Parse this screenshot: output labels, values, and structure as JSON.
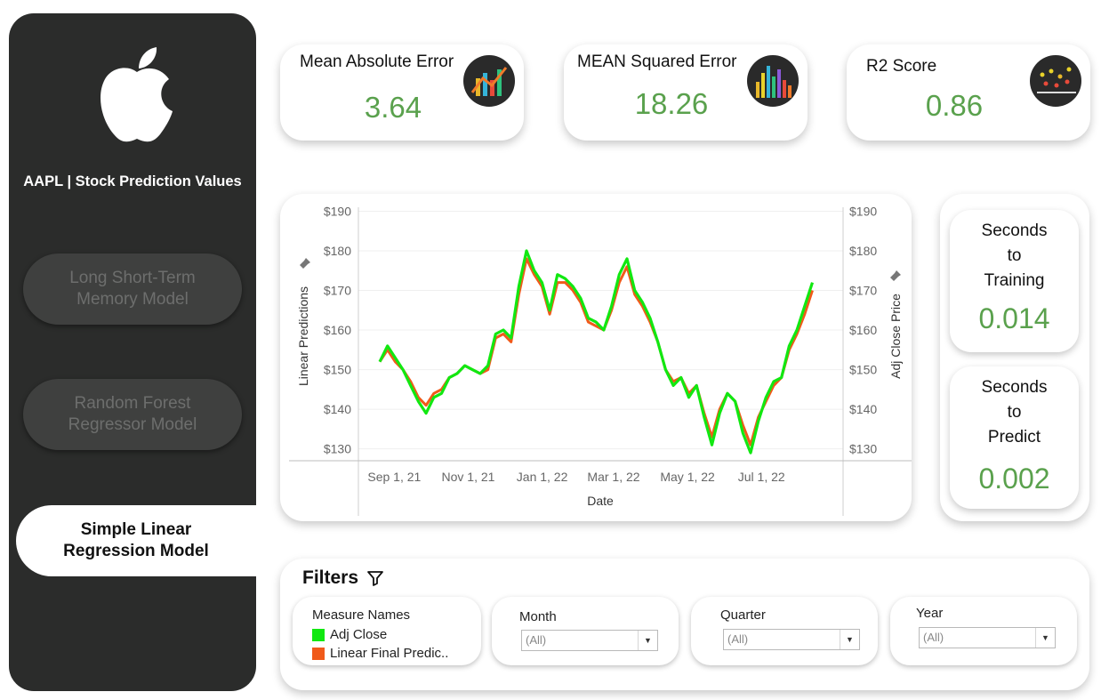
{
  "sidebar": {
    "brand": "AAPL | Stock Prediction Values",
    "models": [
      {
        "label": "Long Short-Term\nMemory Model",
        "active": false
      },
      {
        "label": "Random Forest\nRegressor Model",
        "active": false
      },
      {
        "label": "Simple Linear\nRegression Model",
        "active": true
      }
    ]
  },
  "kpis": {
    "mae": {
      "title": "Mean Absolute Error",
      "value": "3.64",
      "icon": "line-chart-icon"
    },
    "mse": {
      "title": "MEAN Squared Error",
      "value": "18.26",
      "icon": "bar-chart-icon"
    },
    "r2": {
      "title": "R2 Score",
      "value": "0.86",
      "icon": "scatter-plot-icon"
    }
  },
  "timing": {
    "training": {
      "label": "Seconds\nto\nTraining",
      "value": "0.014"
    },
    "predict": {
      "label": "Seconds\nto\nPredict",
      "value": "0.002"
    }
  },
  "filters": {
    "title": "Filters",
    "measure_names": {
      "label": "Measure Names",
      "items": [
        {
          "name": "Adj Close",
          "color": "#11e811"
        },
        {
          "name": "Linear Final Predic..",
          "color": "#f05a1a"
        }
      ]
    },
    "month": {
      "label": "Month",
      "value": "(All)"
    },
    "quarter": {
      "label": "Quarter",
      "value": "(All)"
    },
    "year": {
      "label": "Year",
      "value": "(All)"
    }
  },
  "colors": {
    "accent_green": "#5aa14d",
    "sidebar_bg": "#2b2c2b",
    "adj_close": "#11e811",
    "prediction": "#f05a1a"
  },
  "chart_data": {
    "type": "line",
    "xlabel": "Date",
    "ylabel_left": "Linear Predictions",
    "ylabel_right": "Adj Close Price",
    "x_ticks": [
      "Sep 1, 21",
      "Nov 1, 21",
      "Jan 1, 22",
      "Mar 1, 22",
      "May 1, 22",
      "Jul 1, 22"
    ],
    "y_ticks": [
      "$130",
      "$140",
      "$150",
      "$160",
      "$170",
      "$180",
      "$190"
    ],
    "ylim": [
      127,
      191
    ],
    "x": [
      "2021-08-20",
      "2021-08-27",
      "2021-09-03",
      "2021-09-10",
      "2021-09-17",
      "2021-09-24",
      "2021-10-01",
      "2021-10-08",
      "2021-10-15",
      "2021-10-22",
      "2021-10-29",
      "2021-11-05",
      "2021-11-12",
      "2021-11-19",
      "2021-11-26",
      "2021-12-03",
      "2021-12-10",
      "2021-12-17",
      "2021-12-24",
      "2021-12-31",
      "2022-01-07",
      "2022-01-14",
      "2022-01-21",
      "2022-01-28",
      "2022-02-04",
      "2022-02-11",
      "2022-02-18",
      "2022-02-25",
      "2022-03-04",
      "2022-03-11",
      "2022-03-18",
      "2022-03-25",
      "2022-04-01",
      "2022-04-08",
      "2022-04-15",
      "2022-04-22",
      "2022-04-29",
      "2022-05-06",
      "2022-05-13",
      "2022-05-20",
      "2022-05-27",
      "2022-06-03",
      "2022-06-10",
      "2022-06-17",
      "2022-06-24",
      "2022-07-01",
      "2022-07-08",
      "2022-07-15",
      "2022-07-22",
      "2022-07-29",
      "2022-08-05",
      "2022-08-12"
    ],
    "series": [
      {
        "name": "Adj Close",
        "color": "#11e811",
        "values": [
          152,
          156,
          153,
          150,
          146,
          142,
          139,
          143,
          144,
          148,
          149,
          151,
          150,
          149,
          151,
          159,
          160,
          158,
          171,
          180,
          175,
          172,
          165,
          174,
          173,
          171,
          168,
          163,
          162,
          160,
          166,
          174,
          178,
          170,
          167,
          163,
          157,
          150,
          146,
          148,
          143,
          146,
          138,
          131,
          139,
          144,
          142,
          134,
          129,
          137,
          143,
          147,
          148,
          156,
          160,
          166,
          172
        ]
      },
      {
        "name": "Linear Final Predic..",
        "color": "#f05a1a",
        "values": [
          152,
          155,
          152,
          150,
          147,
          143,
          141,
          144,
          145,
          148,
          149,
          151,
          150,
          149,
          150,
          158,
          159,
          157,
          169,
          178,
          174,
          171,
          164,
          172,
          172,
          170,
          167,
          162,
          161,
          160,
          165,
          172,
          176,
          169,
          166,
          162,
          157,
          150,
          147,
          148,
          144,
          146,
          139,
          133,
          140,
          144,
          142,
          136,
          131,
          138,
          142,
          146,
          148,
          155,
          159,
          164,
          170
        ]
      }
    ]
  }
}
